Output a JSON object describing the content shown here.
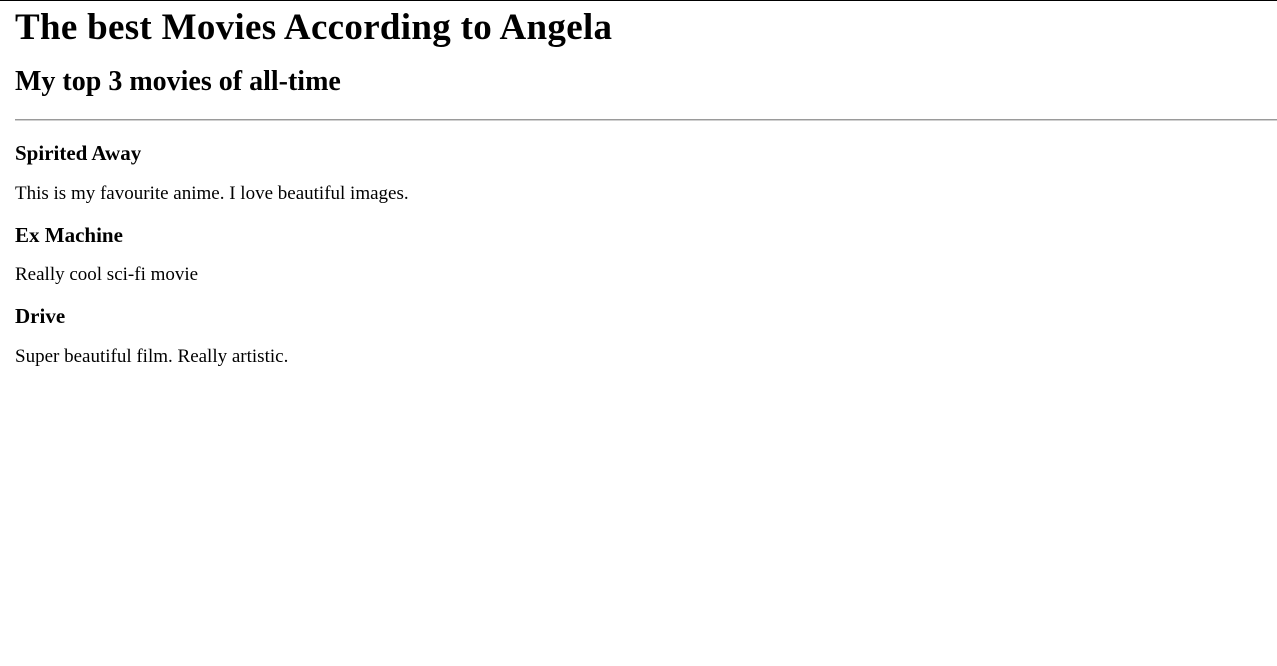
{
  "page": {
    "title": "The best Movies According to Angela",
    "subtitle": "My top 3 movies of all-time"
  },
  "movies": [
    {
      "title": "Spirited Away",
      "description": "This is my favourite anime. I love beautiful images."
    },
    {
      "title": "Ex Machine",
      "description": "Really cool sci-fi movie"
    },
    {
      "title": "Drive",
      "description": "Super beautiful film. Really artistic."
    }
  ]
}
